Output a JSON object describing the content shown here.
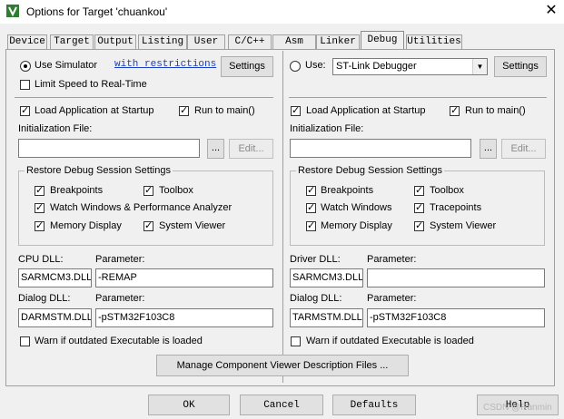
{
  "window": {
    "title": "Options for Target 'chuankou'",
    "close_glyph": "✕",
    "app_icon": "keil-uvision-icon",
    "accent": "#2f7d32"
  },
  "tabs": [
    {
      "label": "Device"
    },
    {
      "label": "Target"
    },
    {
      "label": "Output"
    },
    {
      "label": "Listing"
    },
    {
      "label": "User"
    },
    {
      "label": "C/C++"
    },
    {
      "label": "Asm"
    },
    {
      "label": "Linker"
    },
    {
      "label": "Debug",
      "active": true
    },
    {
      "label": "Utilities"
    }
  ],
  "left": {
    "use_simulator": {
      "label": "Use Simulator",
      "selected": true
    },
    "restrictions_link": "with restrictions",
    "settings_button": "Settings",
    "limit_speed": {
      "label": "Limit Speed to Real-Time",
      "checked": false
    },
    "load_app": {
      "label": "Load Application at Startup",
      "checked": true
    },
    "run_to_main": {
      "label": "Run to main()",
      "checked": true
    },
    "init_file_label": "Initialization File:",
    "init_file_value": "",
    "browse_button": "...",
    "edit_button": "Edit...",
    "restore_group": "Restore Debug Session Settings",
    "restore": {
      "breakpoints": {
        "label": "Breakpoints",
        "checked": true
      },
      "toolbox": {
        "label": "Toolbox",
        "checked": true
      },
      "watch": {
        "label": "Watch Windows & Performance Analyzer",
        "checked": true
      },
      "memory": {
        "label": "Memory Display",
        "checked": true
      },
      "sysviewer": {
        "label": "System Viewer",
        "checked": true
      }
    },
    "cpu_dll_label": "CPU DLL:",
    "cpu_param_label": "Parameter:",
    "cpu_dll_value": "SARMCM3.DLL",
    "cpu_param_value": "-REMAP",
    "dialog_dll_label": "Dialog DLL:",
    "dialog_param_label": "Parameter:",
    "dialog_dll_value": "DARMSTM.DLL",
    "dialog_param_value": "-pSTM32F103C8",
    "warn": {
      "label": "Warn if outdated Executable is loaded",
      "checked": false
    }
  },
  "right": {
    "use": {
      "label": "Use:",
      "selected": false
    },
    "debugger_select": "ST-Link Debugger",
    "settings_button": "Settings",
    "load_app": {
      "label": "Load Application at Startup",
      "checked": true
    },
    "run_to_main": {
      "label": "Run to main()",
      "checked": true
    },
    "init_file_label": "Initialization File:",
    "init_file_value": "",
    "browse_button": "...",
    "edit_button": "Edit...",
    "restore_group": "Restore Debug Session Settings",
    "restore": {
      "breakpoints": {
        "label": "Breakpoints",
        "checked": true
      },
      "toolbox": {
        "label": "Toolbox",
        "checked": true
      },
      "watch": {
        "label": "Watch Windows",
        "checked": true
      },
      "tracepoints": {
        "label": "Tracepoints",
        "checked": true
      },
      "memory": {
        "label": "Memory Display",
        "checked": true
      },
      "sysviewer": {
        "label": "System Viewer",
        "checked": true
      }
    },
    "driver_dll_label": "Driver DLL:",
    "driver_param_label": "Parameter:",
    "driver_dll_value": "SARMCM3.DLL",
    "driver_param_value": "",
    "dialog_dll_label": "Dialog DLL:",
    "dialog_param_label": "Parameter:",
    "dialog_dll_value": "TARMSTM.DLL",
    "dialog_param_value": "-pSTM32F103C8",
    "warn": {
      "label": "Warn if outdated Executable is loaded",
      "checked": false
    }
  },
  "manage_button": "Manage Component Viewer Description Files ...",
  "footer": {
    "ok": "OK",
    "cancel": "Cancel",
    "defaults": "Defaults",
    "help": "Help"
  },
  "watermark": "CSDN @Ranmin"
}
